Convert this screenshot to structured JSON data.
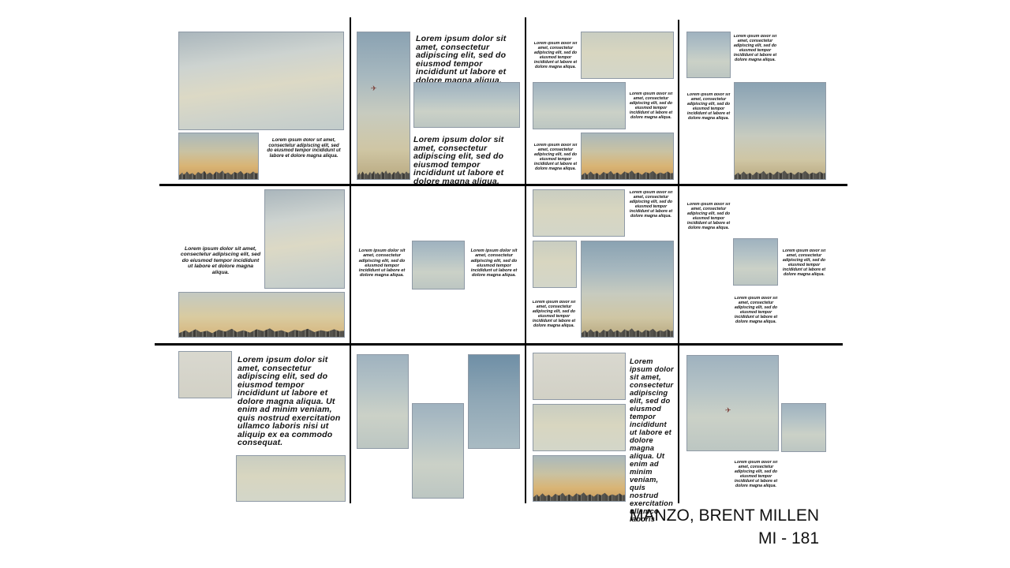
{
  "lorem": {
    "short": "Lorem ipsum dolor sit amet, consectetur adipiscing elit, sed do eiusmod tempor incididunt ut labore et dolore magna aliqua.",
    "narrow": "Lorem ipsum dolor sit amet, consectetur adipiscing elit, sed do eiusmod tempor incididunt ut labore et dolore magna aliqua.",
    "long": "Lorem ipsum dolor sit amet, consectetur adipiscing elit, sed do eiusmod tempor incididunt ut labore et dolore magna aliqua. Ut enim ad minim veniam, quis nostrud exercitation ullamco laboris nisi ut aliquip ex ea commodo consequat.",
    "column": "Lorem ipsum dolor sit amet, consectetur adipiscing elit, sed do eiusmod tempor incididunt ut labore et dolore magna aliqua. Ut enim ad minim veniam, quis nostrud exercitation ullamco laboris"
  },
  "author": {
    "name": "MANZO, BRENT MILLEN",
    "code": "MI - 181"
  },
  "icons": {
    "airplane": "airplane-icon"
  },
  "colors": {
    "grid_lines": "#000000",
    "background": "#ffffff"
  }
}
